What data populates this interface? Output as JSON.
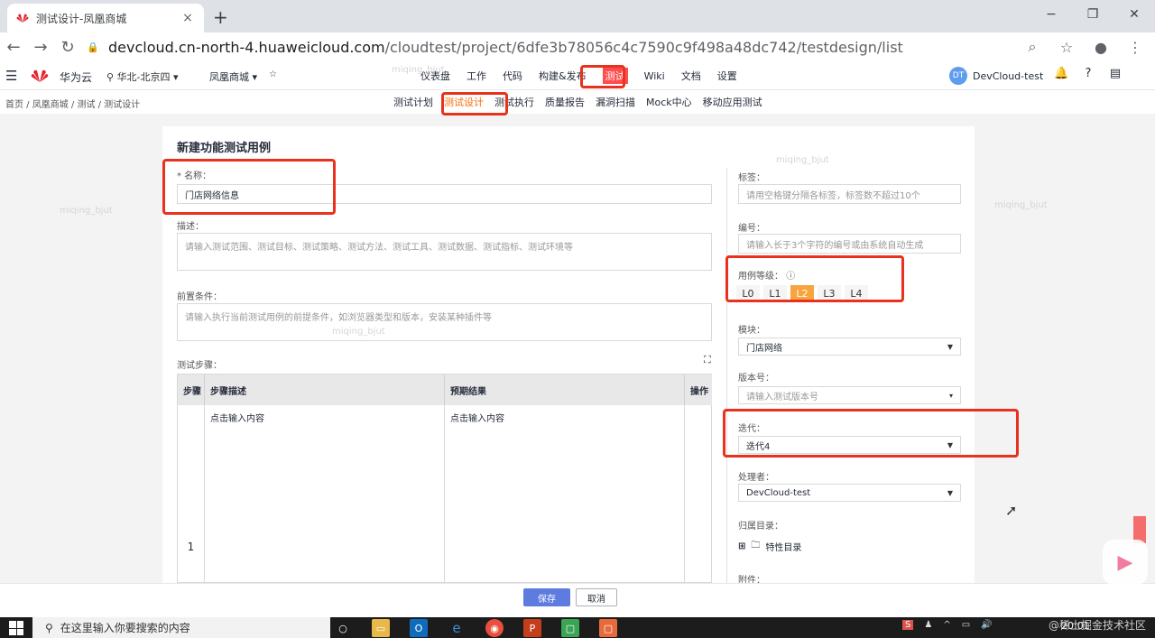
{
  "browser": {
    "tab_title": "测试设计-凤凰商城",
    "tab_close": "×",
    "new_tab": "+",
    "url_host": "devcloud.cn-north-4.huaweicloud.com",
    "url_path": "/cloudtest/project/6dfe3b78056c4c7590c9f498a48dc742/testdesign/list",
    "win_minimize": "−",
    "win_restore": "❐",
    "win_close": "✕"
  },
  "header": {
    "brand": "华为云",
    "region": "华北-北京四",
    "project": "凤凰商城",
    "nav": [
      "仪表盘",
      "工作",
      "代码",
      "构建&发布",
      "测试",
      "Wiki",
      "文档",
      "设置"
    ],
    "active_nav": "测试",
    "user_initials": "DT",
    "user_name": "DevCloud-test"
  },
  "subbar": {
    "breadcrumb": "首页 / 凤凰商城 / 测试 / 测试设计",
    "nav": [
      "测试计划",
      "测试设计",
      "测试执行",
      "质量报告",
      "漏洞扫描",
      "Mock中心",
      "移动应用测试"
    ],
    "active": "测试设计"
  },
  "form": {
    "title": "新建功能测试用例",
    "name_label": "* 名称：",
    "name_value": "门店网络信息",
    "desc_label": "描述：",
    "desc_placeholder": "请输入测试范围、测试目标、测试策略、测试方法、测试工具、测试数据、测试指标、测试环境等",
    "precond_label": "前置条件：",
    "precond_placeholder": "请输入执行当前测试用例的前提条件，如浏览器类型和版本，安装某种插件等",
    "steps_label": "测试步骤：",
    "steps_headers": [
      "步骤",
      "步骤描述",
      "预期结果",
      "操作"
    ],
    "step_number": "1",
    "step_desc": "点击输入内容",
    "step_expected": "点击输入内容",
    "tags_label": "标签：",
    "tags_placeholder": "请用空格键分隔各标签，标签数不超过10个",
    "number_label": "编号：",
    "number_placeholder": "请输入长于3个字符的编号或由系统自动生成",
    "level_label": "用例等级：",
    "levels": [
      "L0",
      "L1",
      "L2",
      "L3",
      "L4"
    ],
    "active_level": "L2",
    "module_label": "模块：",
    "module_value": "门店网络",
    "version_label": "版本号：",
    "version_placeholder": "请输入测试版本号",
    "iteration_label": "迭代：",
    "iteration_value": "迭代4",
    "handler_label": "处理者：",
    "handler_value": "DevCloud-test",
    "dir_label": "归属目录：",
    "dir_value": "特性目录",
    "attach_label": "附件：",
    "save": "保存",
    "cancel": "取消"
  },
  "taskbar": {
    "search_placeholder": "在这里输入你要搜索的内容",
    "clock": "20:01"
  },
  "watermark": "@稀土掘金技术社区",
  "page_watermark": "miqing_bjut",
  "colors": {
    "accent": "#5e7ce0",
    "highlight_red": "#e8321d",
    "level_active": "#f7a33e",
    "nav_active": "#ff4d4f"
  }
}
